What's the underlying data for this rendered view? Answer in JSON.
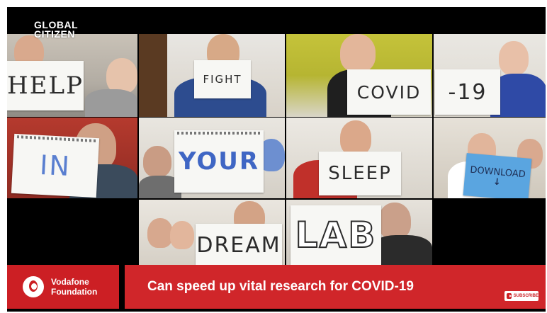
{
  "logo": {
    "line1": "GLOBAL",
    "line2": "CITIZEN"
  },
  "signs": {
    "help": "HELP",
    "fight": "FIGHT",
    "covid": "COVID",
    "nineteen": "-19",
    "in": "IN",
    "your": "YOUR",
    "sleep": "SLEEP",
    "download": "DOWNLOAD",
    "dream": "DREAM",
    "lab": "LAB"
  },
  "lower_third": {
    "brand_line1": "Vodafone",
    "brand_line2": "Foundation",
    "caption": "Can speed up vital research for COVID-19"
  },
  "subscribe_label": "SUBSCRIBE",
  "colors": {
    "brand_red": "#cc1f24",
    "caption_red": "#d0262a",
    "sign_paper": "#f7f7f4",
    "download_sign": "#5aa5e0"
  },
  "icons": [
    "vodafone-logo-icon",
    "youtube-play-icon",
    "arrow-down-icon"
  ]
}
